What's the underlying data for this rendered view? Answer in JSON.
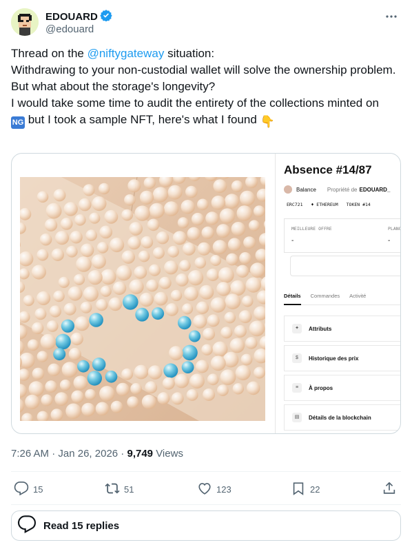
{
  "author": {
    "name": "EDOUARD",
    "handle": "@edouard"
  },
  "tweet": {
    "line1_prefix": "Thread on the ",
    "line1_mention": "@niftygateway",
    "line1_suffix": " situation:",
    "line2": "Withdrawing to your non-custodial wallet will solve the ownership problem.",
    "line3": "But what about the storage's longevity?",
    "line4": "I would take some time to audit the entirety of the collections minted on",
    "ng_badge": "NG",
    "line5": " but I took a sample NFT, here's what I found ",
    "emoji": "👇"
  },
  "nft_panel": {
    "title": "Absence #14/87",
    "owner_name": "Balance",
    "owner_label": "Propriété de",
    "owner_value": "EDOUARD_",
    "tags": [
      "ERC721",
      "♦ ETHEREUM",
      "TOKEN #14"
    ],
    "offer_label": "MEILLEURE OFFRE",
    "offer_value": "-",
    "floor_label": "PLANC",
    "floor_value": "-",
    "tabs": [
      "Détails",
      "Commandes",
      "Activité"
    ],
    "items": [
      {
        "icon": "✦",
        "label": "Attributs"
      },
      {
        "icon": "$",
        "label": "Historique des prix"
      },
      {
        "icon": "≡",
        "label": "À propos"
      },
      {
        "icon": "▤",
        "label": "Détails de la blockchain"
      }
    ]
  },
  "meta": {
    "time": "7:26 AM",
    "sep": " · ",
    "date": "Jan 26, 2026",
    "views_count": "9,749",
    "views_label": " Views"
  },
  "actions": {
    "replies": "15",
    "reposts": "51",
    "likes": "123",
    "bookmarks": "22"
  },
  "read_replies": "Read 15 replies",
  "colors": {
    "accent": "#1d9bf0",
    "text": "#0f1419",
    "muted": "#536471",
    "border": "#cfd9de"
  }
}
